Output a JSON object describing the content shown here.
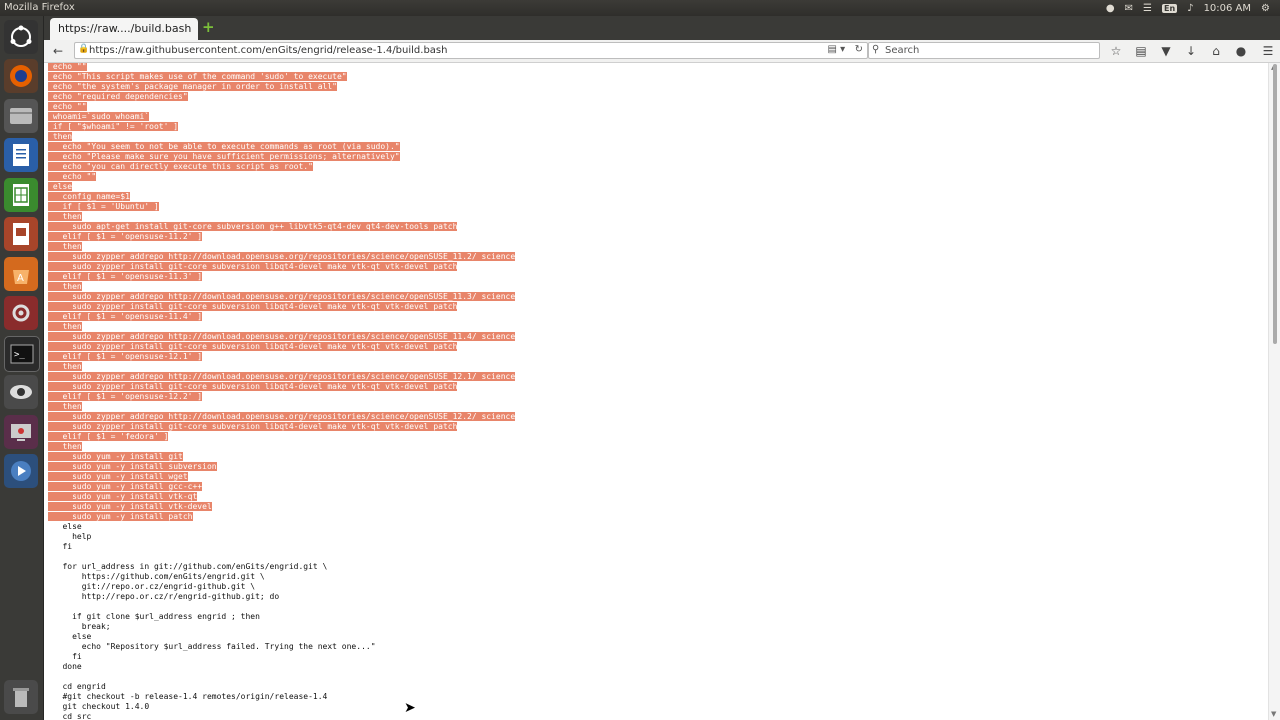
{
  "system": {
    "window_title": "Mozilla Firefox",
    "keyboard": "En",
    "time": "10:06 AM"
  },
  "browser": {
    "tab_title": "https://raw..../build.bash",
    "url": "https://raw.githubusercontent.com/enGits/engrid/release-1.4/build.bash",
    "search_placeholder": "Search"
  },
  "code": {
    "selection_color": "#e8856a",
    "lines": [
      {
        "text": " echo \"\"",
        "sel": true
      },
      {
        "text": " echo \"This script makes use of the command 'sudo' to execute\"",
        "sel": true
      },
      {
        "text": " echo \"the system's package manager in order to install all\"",
        "sel": true
      },
      {
        "text": " echo \"required dependencies\"",
        "sel": true
      },
      {
        "text": " echo \"\"",
        "sel": true
      },
      {
        "text": " whoami=`sudo whoami`",
        "sel": true
      },
      {
        "text": " if [ \"$whoami\" != 'root' ]",
        "sel": true
      },
      {
        "text": " then",
        "sel": true
      },
      {
        "text": "   echo \"You seem to not be able to execute commands as root (via sudo).\"",
        "sel": true
      },
      {
        "text": "   echo \"Please make sure you have sufficient permissions; alternatively\"",
        "sel": true
      },
      {
        "text": "   echo \"you can directly execute this script as root.\"",
        "sel": true
      },
      {
        "text": "   echo \"\"",
        "sel": true
      },
      {
        "text": " else",
        "sel": true
      },
      {
        "text": "   config_name=$1",
        "sel": true
      },
      {
        "text": "   if [ $1 = 'Ubuntu' ]",
        "sel": true
      },
      {
        "text": "   then",
        "sel": true
      },
      {
        "text": "     sudo apt-get install git-core subversion g++ libvtk5-qt4-dev qt4-dev-tools patch",
        "sel": true
      },
      {
        "text": "   elif [ $1 = 'opensuse-11.2' ]",
        "sel": true
      },
      {
        "text": "   then",
        "sel": true
      },
      {
        "text": "     sudo zypper addrepo http://download.opensuse.org/repositories/science/openSUSE_11.2/ science",
        "sel": true
      },
      {
        "text": "     sudo zypper install git-core subversion libqt4-devel make vtk-qt vtk-devel patch",
        "sel": true
      },
      {
        "text": "   elif [ $1 = 'opensuse-11.3' ]",
        "sel": true
      },
      {
        "text": "   then",
        "sel": true
      },
      {
        "text": "     sudo zypper addrepo http://download.opensuse.org/repositories/science/openSUSE_11.3/ science",
        "sel": true
      },
      {
        "text": "     sudo zypper install git-core subversion libqt4-devel make vtk-qt vtk-devel patch",
        "sel": true
      },
      {
        "text": "   elif [ $1 = 'opensuse-11.4' ]",
        "sel": true
      },
      {
        "text": "   then",
        "sel": true
      },
      {
        "text": "     sudo zypper addrepo http://download.opensuse.org/repositories/science/openSUSE_11.4/ science",
        "sel": true
      },
      {
        "text": "     sudo zypper install git-core subversion libqt4-devel make vtk-qt vtk-devel patch",
        "sel": true
      },
      {
        "text": "   elif [ $1 = 'opensuse-12.1' ]",
        "sel": true
      },
      {
        "text": "   then",
        "sel": true
      },
      {
        "text": "     sudo zypper addrepo http://download.opensuse.org/repositories/science/openSUSE_12.1/ science",
        "sel": true
      },
      {
        "text": "     sudo zypper install git-core subversion libqt4-devel make vtk-qt vtk-devel patch",
        "sel": true
      },
      {
        "text": "   elif [ $1 = 'opensuse-12.2' ]",
        "sel": true
      },
      {
        "text": "   then",
        "sel": true
      },
      {
        "text": "     sudo zypper addrepo http://download.opensuse.org/repositories/science/openSUSE_12.2/ science",
        "sel": true
      },
      {
        "text": "     sudo zypper install git-core subversion libqt4-devel make vtk-qt vtk-devel patch",
        "sel": true
      },
      {
        "text": "   elif [ $1 = 'fedora' ]",
        "sel": true
      },
      {
        "text": "   then",
        "sel": true
      },
      {
        "text": "     sudo yum -y install git",
        "sel": true
      },
      {
        "text": "     sudo yum -y install subversion",
        "sel": true
      },
      {
        "text": "     sudo yum -y install wget",
        "sel": true
      },
      {
        "text": "     sudo yum -y install gcc-c++",
        "sel": true
      },
      {
        "text": "     sudo yum -y install vtk-qt",
        "sel": true
      },
      {
        "text": "     sudo yum -y install vtk-devel",
        "sel": true
      },
      {
        "text": "     sudo yum -y install patch",
        "sel": true
      },
      {
        "text": "   else",
        "sel": false
      },
      {
        "text": "     help",
        "sel": false
      },
      {
        "text": "   fi",
        "sel": false
      },
      {
        "text": "",
        "sel": false
      },
      {
        "text": "   for url_address in git://github.com/enGits/engrid.git \\",
        "sel": false
      },
      {
        "text": "       https://github.com/enGits/engrid.git \\",
        "sel": false
      },
      {
        "text": "       git://repo.or.cz/engrid-github.git \\",
        "sel": false
      },
      {
        "text": "       http://repo.or.cz/r/engrid-github.git; do",
        "sel": false
      },
      {
        "text": "",
        "sel": false
      },
      {
        "text": "     if git clone $url_address engrid ; then",
        "sel": false
      },
      {
        "text": "       break;",
        "sel": false
      },
      {
        "text": "     else",
        "sel": false
      },
      {
        "text": "       echo \"Repository $url_address failed. Trying the next one...\"",
        "sel": false
      },
      {
        "text": "     fi",
        "sel": false
      },
      {
        "text": "   done",
        "sel": false
      },
      {
        "text": "",
        "sel": false
      },
      {
        "text": "   cd engrid",
        "sel": false
      },
      {
        "text": "   #git checkout -b release-1.4 remotes/origin/release-1.4",
        "sel": false
      },
      {
        "text": "   git checkout 1.4.0",
        "sel": false
      },
      {
        "text": "   cd src",
        "sel": false
      }
    ]
  },
  "launcher": {
    "icons": [
      "ubuntu-dash",
      "firefox",
      "files",
      "libreoffice-writer",
      "libreoffice-calc",
      "libreoffice-impress",
      "software-center",
      "system-settings",
      "terminal",
      "eye-app",
      "screen-recorder",
      "video-player",
      "trash"
    ]
  }
}
